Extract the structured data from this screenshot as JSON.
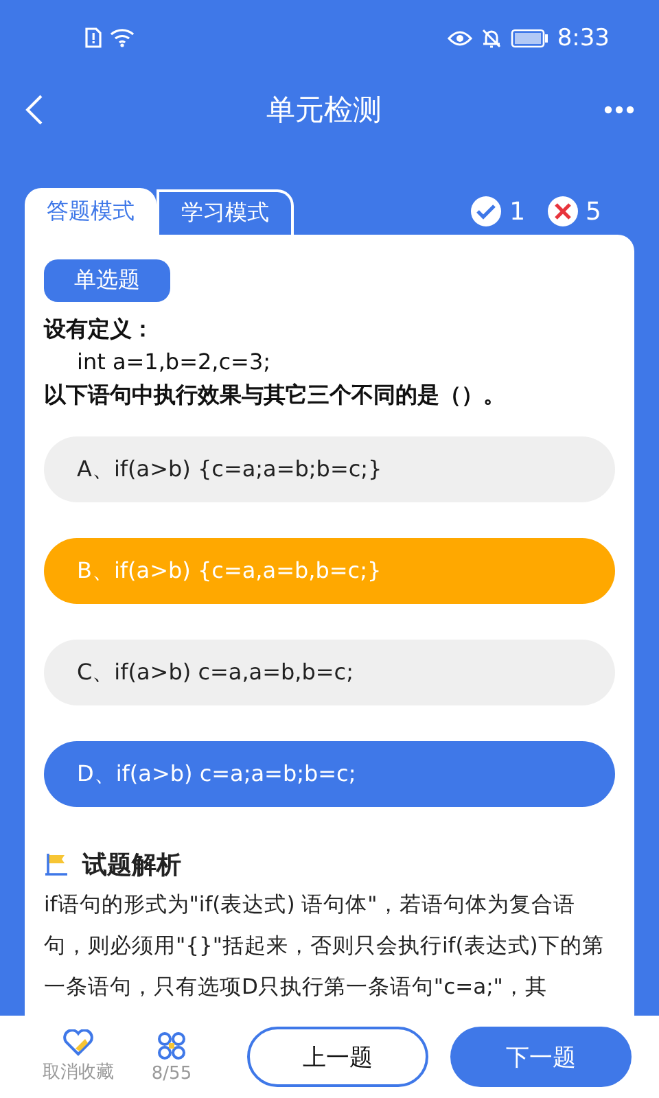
{
  "status_bar": {
    "time": "8:33"
  },
  "header": {
    "title": "单元检测"
  },
  "tabs": [
    {
      "label": "答题模式",
      "selected": true
    },
    {
      "label": "学习模式",
      "selected": false
    }
  ],
  "score": {
    "correct": "1",
    "wrong": "5"
  },
  "question": {
    "type": "单选题",
    "lines": [
      "设有定义：",
      "int  a=1,b=2,c=3;",
      "以下语句中执行效果与其它三个不同的是（）。"
    ]
  },
  "options": [
    {
      "label": "A、if(a>b) {c=a;a=b;b=c;}",
      "selected": false,
      "correct": false
    },
    {
      "label": "B、if(a>b) {c=a,a=b,b=c;}",
      "selected": true,
      "correct": false
    },
    {
      "label": "C、if(a>b) c=a,a=b,b=c;",
      "selected": false,
      "correct": false
    },
    {
      "label": "D、if(a>b) c=a;a=b;b=c;",
      "selected": false,
      "correct": true
    }
  ],
  "analysis": {
    "title": "试题解析",
    "text": "if语句的形式为\"if(表达式) 语句体\"，若语句体为复合语句，则必须用\"{}\"括起来，否则只会执行if(表达式)下的第一条语句，只有选项D只执行第一条语句\"c=a;\"，其"
  },
  "bottom_bar": {
    "favorite": "取消收藏",
    "progress": "8/55",
    "prev": "上一题",
    "next": "下一题"
  }
}
